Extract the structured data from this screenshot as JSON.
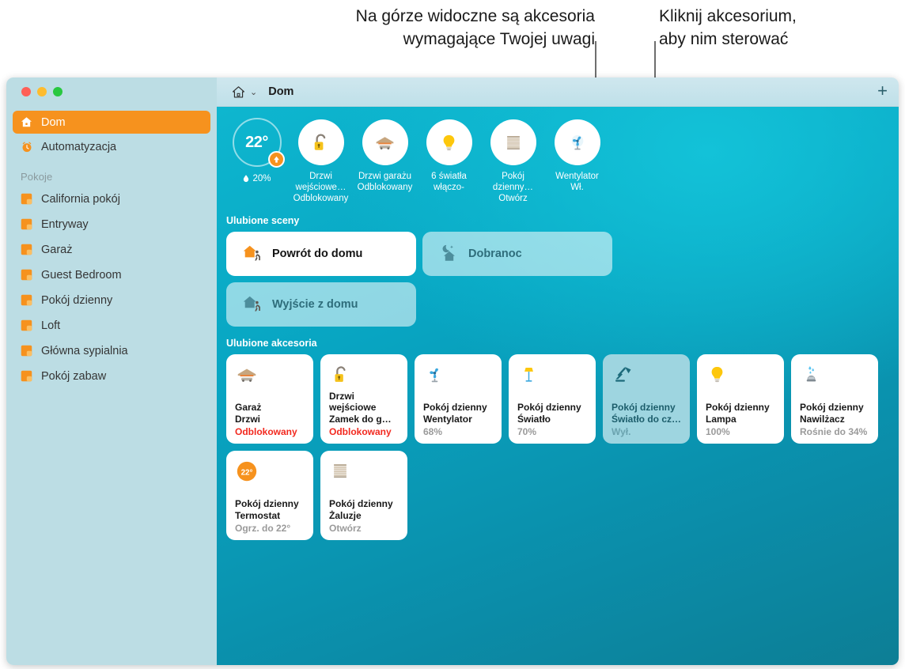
{
  "annotations": {
    "callout_left": "Na górze widoczne są akcesoria\nwymagające Twojej uwagi",
    "callout_right": "Kliknij akcesorium,\naby nim sterować"
  },
  "window": {
    "title": "Dom",
    "home_icon": "home-icon",
    "chevron": "⌄",
    "add_label": "+",
    "traffic_lights": [
      "close-button",
      "minimize-button",
      "zoom-button"
    ]
  },
  "sidebar": {
    "nav": [
      {
        "label": "Dom",
        "icon": "home-icon",
        "active": true
      },
      {
        "label": "Automatyzacja",
        "icon": "automation-clock-icon",
        "active": false
      }
    ],
    "rooms_header": "Pokoje",
    "rooms": [
      {
        "label": "California pokój",
        "icon": "room-icon"
      },
      {
        "label": "Entryway",
        "icon": "room-icon"
      },
      {
        "label": "Garaż",
        "icon": "room-icon"
      },
      {
        "label": "Guest Bedroom",
        "icon": "room-icon"
      },
      {
        "label": "Pokój dzienny",
        "icon": "room-icon"
      },
      {
        "label": "Loft",
        "icon": "room-icon"
      },
      {
        "label": "Główna sypialnia",
        "icon": "room-icon"
      },
      {
        "label": "Pokój zabaw",
        "icon": "room-icon"
      }
    ]
  },
  "status": {
    "temperature": "22°",
    "humidity": "20%",
    "humidity_icon": "droplet-icon",
    "trend_icon": "arrow-up-icon",
    "items": [
      {
        "icon": "unlocked-padlock-icon",
        "line1": "Drzwi wejściowe…",
        "line2": "Odblokowany"
      },
      {
        "icon": "garage-door-icon",
        "line1": "Drzwi garażu",
        "line2": "Odblokowany"
      },
      {
        "icon": "lightbulb-icon",
        "line1": "6 światła",
        "line2": "włączo-"
      },
      {
        "icon": "blinds-icon",
        "line1": "Pokój dzienny…",
        "line2": "Otwórz"
      },
      {
        "icon": "fan-icon",
        "line1": "Wentylator",
        "line2": "Wł."
      }
    ]
  },
  "scenes": {
    "title": "Ulubione sceny",
    "items": [
      {
        "label": "Powrót do domu",
        "icon": "house-walking-icon",
        "active": true
      },
      {
        "label": "Dobranoc",
        "icon": "moon-house-icon",
        "active": false
      },
      {
        "label": "Wyjście z domu",
        "icon": "house-walking-icon",
        "active": false
      }
    ]
  },
  "accessories": {
    "title": "Ulubione akcesoria",
    "items": [
      {
        "icon": "garage-door-icon",
        "name": "Garaż\nDrzwi",
        "state": "Odblokowany",
        "alert": true,
        "selected": false
      },
      {
        "icon": "unlocked-padlock-icon",
        "name": "Drzwi wejściowe\nZamek do g…",
        "state": "Odblokowany",
        "alert": true,
        "selected": false
      },
      {
        "icon": "fan-icon",
        "name": "Pokój dzienny\nWentylator",
        "state": "68%",
        "alert": false,
        "selected": false
      },
      {
        "icon": "floor-lamp-icon",
        "name": "Pokój dzienny\nŚwiatło",
        "state": "70%",
        "alert": false,
        "selected": false
      },
      {
        "icon": "desk-lamp-icon",
        "name": "Pokój dzienny\nŚwiatło do cz…",
        "state": "Wył.",
        "alert": false,
        "selected": true
      },
      {
        "icon": "lightbulb-icon",
        "name": "Pokój dzienny\nLampa",
        "state": "100%",
        "alert": false,
        "selected": false
      },
      {
        "icon": "humidifier-icon",
        "name": "Pokój dzienny\nNawilżacz",
        "state": "Rośnie do 34%",
        "alert": false,
        "selected": false
      },
      {
        "icon": "thermostat-icon",
        "name": "Pokój dzienny\nTermostat",
        "state": "Ogrz. do 22°",
        "alert": false,
        "selected": false
      },
      {
        "icon": "blinds-icon",
        "name": "Pokój dzienny\nŻaluzje",
        "state": "Otwórz",
        "alert": false,
        "selected": false
      }
    ],
    "thermostat_badge": "22°"
  },
  "colors": {
    "accent_orange": "#f6921e",
    "alert_red": "#f2291f",
    "sidebar_bg": "#bcdde4",
    "selected_tile": "#9ed5e0"
  }
}
